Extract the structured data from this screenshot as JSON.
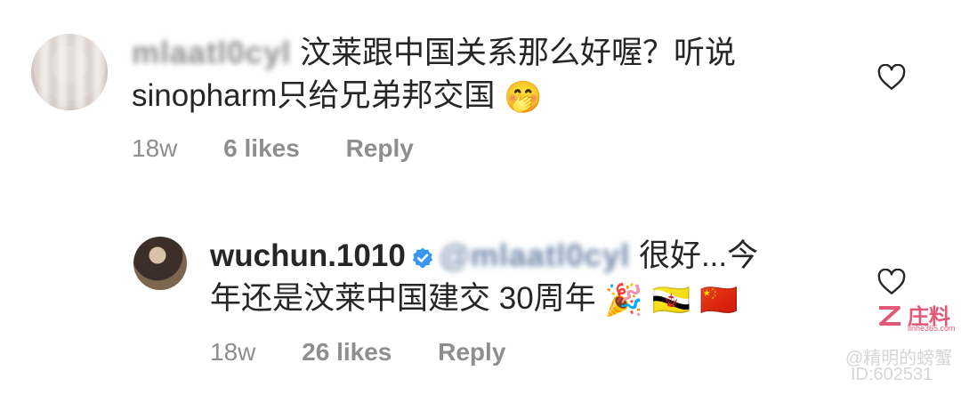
{
  "comment1": {
    "username_blurred": "mlaatl0cyl",
    "text_line1": "汶莱跟中国关系那么好喔？听说",
    "text_line2": "sinopharm只给兄弟邦交国",
    "emoji": "🤭",
    "time": "18w",
    "likes": "6 likes",
    "reply": "Reply"
  },
  "comment2": {
    "username": "wuchun.1010",
    "mention_blurred": "@mlaatl0cyl",
    "text_line1_tail": "很好...今",
    "text_line2": "年还是汶莱中国建交 30周年",
    "emojis": [
      "🎉",
      "🇧🇳",
      "🇨🇳"
    ],
    "time": "18w",
    "likes": "26 likes",
    "reply": "Reply"
  },
  "watermark": {
    "logo": "庄料",
    "sub": "linhe365.com",
    "line1": "@精明的螃蟹",
    "line2": "ID:602531"
  },
  "colors": {
    "text": "#262626",
    "secondary": "#8e8e8e",
    "verified": "#3897f0",
    "watermark_accent": "#e05a77"
  },
  "icons": {
    "like": "heart-outline-icon",
    "verified": "verified-badge-icon"
  }
}
